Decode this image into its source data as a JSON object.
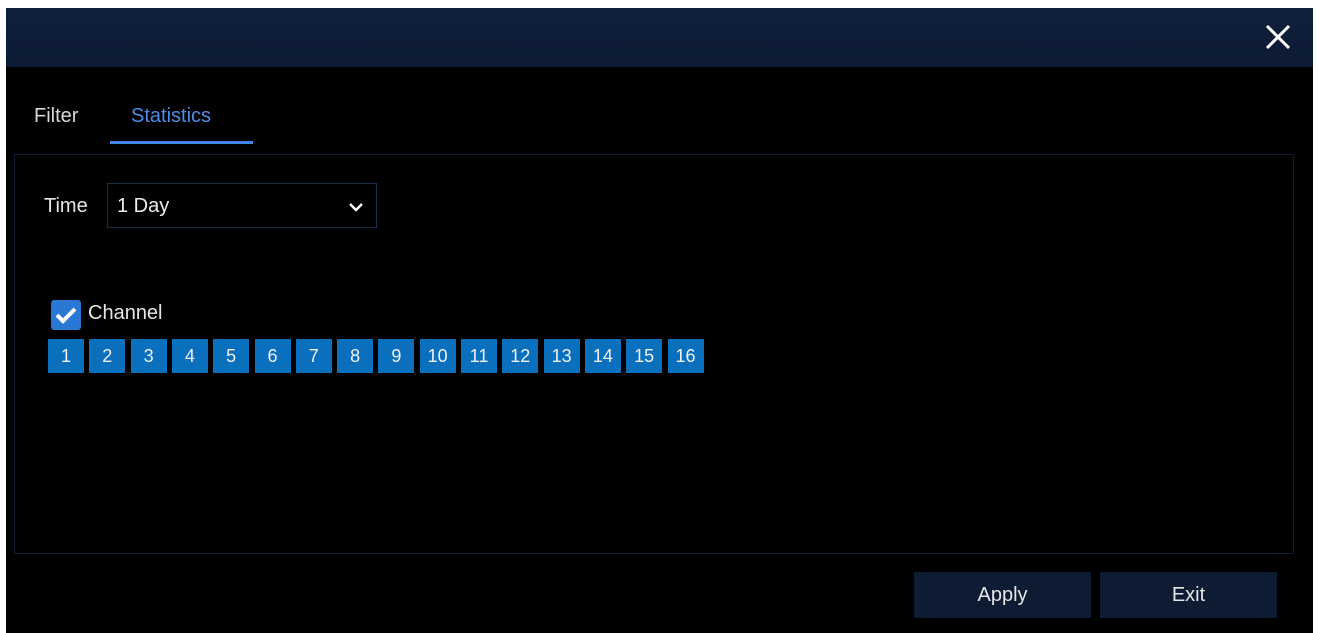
{
  "window": {
    "close_icon": "close-icon"
  },
  "tabs": [
    {
      "label": "Filter",
      "active": false
    },
    {
      "label": "Statistics",
      "active": true
    }
  ],
  "time": {
    "label": "Time",
    "selected": "1 Day",
    "icon": "chevron-down-icon"
  },
  "channel": {
    "label": "Channel",
    "checked": true,
    "buttons": [
      "1",
      "2",
      "3",
      "4",
      "5",
      "6",
      "7",
      "8",
      "9",
      "10",
      "11",
      "12",
      "13",
      "14",
      "15",
      "16"
    ]
  },
  "footer": {
    "apply_label": "Apply",
    "exit_label": "Exit"
  },
  "colors": {
    "accent": "#3f86e6",
    "channel_button": "#0a6fbd",
    "titlebar": "#10203d",
    "button_bg": "#0d1b33"
  }
}
